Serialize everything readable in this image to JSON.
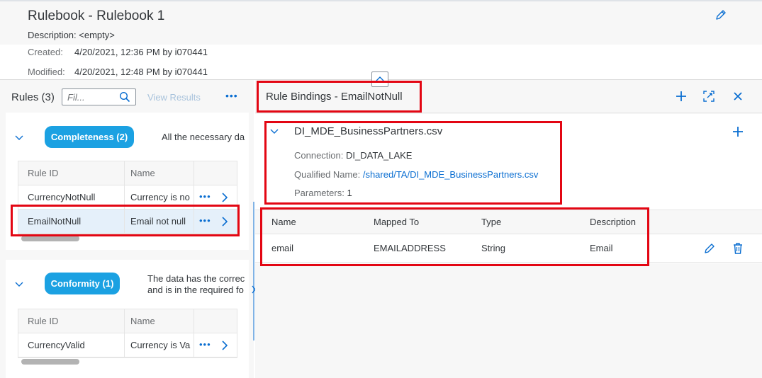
{
  "header": {
    "title": "Rulebook - Rulebook 1",
    "description": "Description: <empty>",
    "created_label": "Created:",
    "created_value": "4/20/2021, 12:36 PM by i070441",
    "modified_label": "Modified:",
    "modified_value": "4/20/2021, 12:48 PM by i070441",
    "icons": {
      "edit": "pencil-icon",
      "collapse": "chevron-up-icon"
    }
  },
  "rules_panel": {
    "title": "Rules (3)",
    "filter_placeholder": "Fil...",
    "view_results_label": "View Results",
    "more_label": "•••",
    "categories": [
      {
        "badge": "Completeness (2)",
        "description": "All the necessary da",
        "columns": [
          "Rule ID",
          "Name"
        ],
        "rows": [
          {
            "rule_id": "CurrencyNotNull",
            "name": "Currency is no",
            "more": "•••"
          },
          {
            "rule_id": "EmailNotNull",
            "name": "Email not null",
            "more": "•••",
            "selected": true
          }
        ]
      },
      {
        "badge": "Conformity (1)",
        "description_line1": "The data has the correc",
        "description_line2": "and is in the required fo",
        "columns": [
          "Rule ID",
          "Name"
        ],
        "rows": [
          {
            "rule_id": "CurrencyValid",
            "name": "Currency is Va",
            "more": "•••"
          }
        ]
      }
    ]
  },
  "bindings_panel": {
    "title": "Rule Bindings - EmailNotNull",
    "file": {
      "name": "DI_MDE_BusinessPartners.csv",
      "connection_label": "Connection:",
      "connection_value": "DI_DATA_LAKE",
      "qualified_label": "Qualified Name:",
      "qualified_value": "/shared/TA/DI_MDE_BusinessPartners.csv",
      "parameters_label": "Parameters:",
      "parameters_value": "1"
    },
    "table": {
      "columns": [
        "Name",
        "Mapped To",
        "Type",
        "Description"
      ],
      "rows": [
        {
          "name": "email",
          "mapped_to": "EMAILADDRESS",
          "type": "String",
          "description": "Email"
        }
      ]
    },
    "icons": [
      "plus-icon",
      "expand-icon",
      "close-icon",
      "pencil-icon",
      "trash-icon"
    ]
  },
  "colors": {
    "accent": "#0a6ed1",
    "badge": "#1ba1e2",
    "annotation": "#e30613",
    "selected_row": "#e5f0fa"
  }
}
